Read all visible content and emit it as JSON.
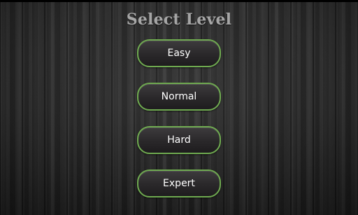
{
  "screen": {
    "title": "Select Level"
  },
  "levels": [
    {
      "label": "Easy"
    },
    {
      "label": "Normal"
    },
    {
      "label": "Hard"
    },
    {
      "label": "Expert"
    }
  ],
  "colors": {
    "button_border": "#6faa50",
    "title_text": "#a6a6a6",
    "button_text": "#ffffff",
    "background": "#262626"
  }
}
